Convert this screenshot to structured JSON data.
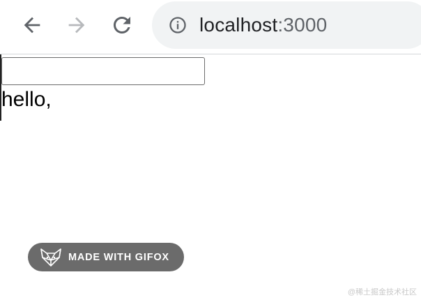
{
  "toolbar": {
    "url_host": "localhost",
    "url_port": ":3000",
    "icons": {
      "back": "back-arrow-icon",
      "forward": "forward-arrow-icon",
      "reload": "reload-icon",
      "site_info": "info-icon"
    },
    "forward_enabled": false
  },
  "page": {
    "input_value": "",
    "greeting": "hello,"
  },
  "badge": {
    "label": "MADE WITH GIFOX",
    "icon": "fox-logo-icon"
  },
  "watermark": "@稀土掘金技术社区",
  "colors": {
    "omnibox_bg": "#f1f3f4",
    "icon_active": "#5f6368",
    "icon_disabled": "#b7b9bc",
    "badge_bg": "#6b6b6b"
  }
}
